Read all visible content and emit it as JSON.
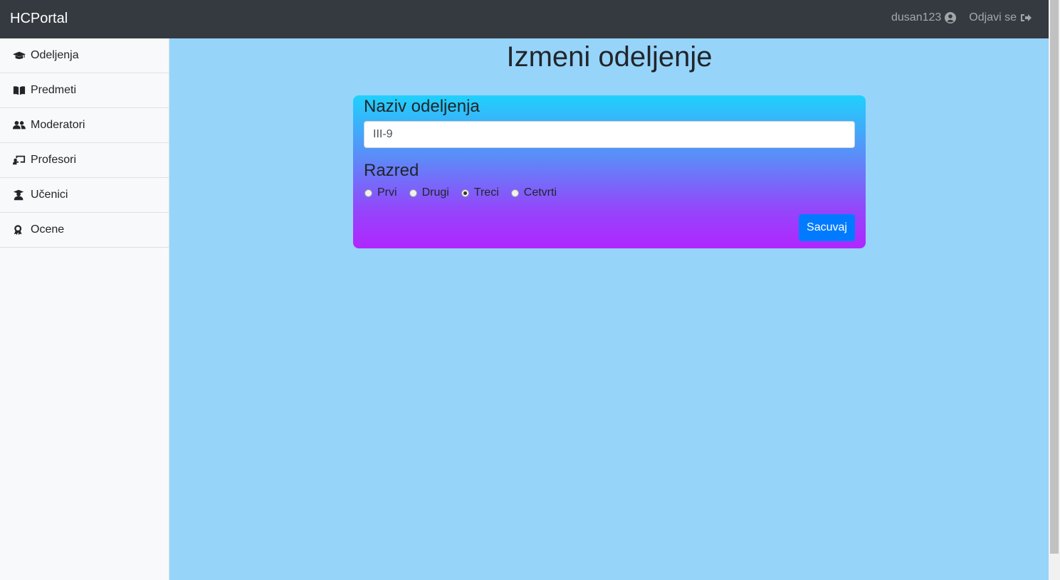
{
  "navbar": {
    "brand": "HCPortal",
    "username": "dusan123",
    "logout": "Odjavi se"
  },
  "sidebar": {
    "items": [
      {
        "label": "Odeljenja",
        "icon": "graduation-cap-icon"
      },
      {
        "label": "Predmeti",
        "icon": "book-icon"
      },
      {
        "label": "Moderatori",
        "icon": "users-icon"
      },
      {
        "label": "Profesori",
        "icon": "chalkboard-teacher-icon"
      },
      {
        "label": "Učenici",
        "icon": "user-graduate-icon"
      },
      {
        "label": "Ocene",
        "icon": "award-icon"
      }
    ]
  },
  "main": {
    "title": "Izmeni odeljenje",
    "form": {
      "name_label": "Naziv odeljenja",
      "name_value": "III-9",
      "grade_label": "Razred",
      "grades": [
        "Prvi",
        "Drugi",
        "Treci",
        "Cetvrti"
      ],
      "selected_grade": "Treci",
      "save_label": "Sacuvaj"
    }
  },
  "colors": {
    "navbar": "#343a40",
    "background": "#97d4fa",
    "card_gradient_top": "#1fd1fc",
    "card_gradient_bottom": "#b026ff",
    "button": "#007bff"
  }
}
